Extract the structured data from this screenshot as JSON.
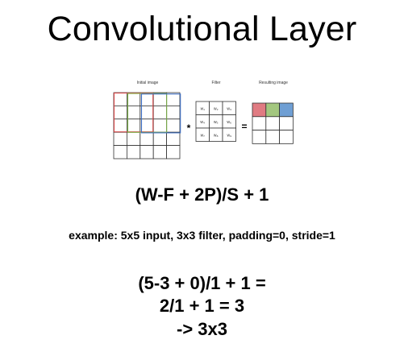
{
  "title": "Convolutional Layer",
  "diagram": {
    "labels": {
      "initial": "Initial image",
      "filter": "Filter",
      "result": "Resulting image"
    },
    "operators": {
      "convolve": "*",
      "equals": "="
    },
    "initial_grid": {
      "rows": 5,
      "cols": 5
    },
    "filter_grid": {
      "rows": 3,
      "cols": 3,
      "cells": [
        "w₁",
        "w₂",
        "w₃",
        "w₄",
        "w₅",
        "w₆",
        "w₇",
        "w₈",
        "w₉"
      ]
    },
    "result_grid": {
      "rows": 3,
      "cols": 3,
      "highlight_colors": [
        "#e07b82",
        "#a3c77f",
        "#6f9fd4"
      ]
    },
    "receptive_field_colors": [
      "#d44a4a",
      "#7fb34a",
      "#3d6fc4"
    ]
  },
  "formula": "(W-F + 2P)/S + 1",
  "example": "example: 5x5 input, 3x3 filter, padding=0, stride=1",
  "calculation": {
    "line1": "(5-3 + 0)/1 + 1 =",
    "line2": "2/1 + 1 = 3",
    "line3": "-> 3x3"
  }
}
